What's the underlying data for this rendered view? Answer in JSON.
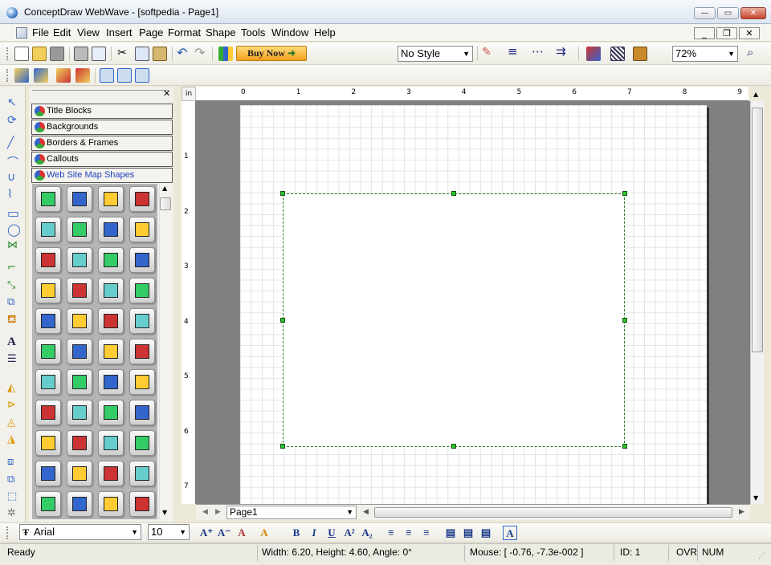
{
  "window": {
    "title": "ConceptDraw WebWave - [softpedia - Page1]",
    "minimize": "—",
    "maximize": "▭",
    "close": "✕"
  },
  "menu": {
    "items": [
      "File",
      "Edit",
      "View",
      "Insert",
      "Page",
      "Format",
      "Shape",
      "Tools",
      "Window",
      "Help"
    ],
    "mdi_min": "_",
    "mdi_restore": "❐",
    "mdi_close": "✕"
  },
  "toolbar": {
    "buy_now": "Buy Now",
    "style_value": "No Style",
    "zoom_value": "72%"
  },
  "library": {
    "tabs": [
      "Title Blocks",
      "Backgrounds",
      "Borders & Frames",
      "Callouts",
      "Web Site Map Shapes"
    ],
    "active_tab_color": "#1f3fbf",
    "icons": [
      [
        "page",
        "home",
        "folder",
        "FTP"
      ],
      [
        "mail",
        "servers",
        "find-doc",
        "find-doc"
      ],
      [
        "P",
        "scroll",
        "JS",
        "shapes"
      ],
      [
        "play",
        "save",
        "?",
        "home-x"
      ],
      [
        "x-doc",
        "ie-doc",
        "mail-doc",
        "dollar-doc"
      ],
      [
        "php-doc",
        "PHP",
        "ASP",
        "ASP.NET"
      ],
      [
        "pen-doc",
        "blank-doc",
        "text-doc",
        "home-doc"
      ],
      [
        "FTP",
        "folder",
        "mail",
        "servers"
      ],
      [
        "find",
        "find",
        "P",
        "scroll"
      ],
      [
        "JS",
        "shapes",
        "play",
        "save"
      ],
      [
        "?",
        "home-x",
        "x",
        "ie"
      ]
    ]
  },
  "ruler": {
    "unit": "in",
    "h_labels": [
      "0",
      "1",
      "2",
      "3",
      "4",
      "5",
      "6",
      "7",
      "8",
      "9"
    ],
    "v_labels": [
      "1",
      "2",
      "3",
      "4",
      "5",
      "6",
      "7"
    ]
  },
  "page_tab": {
    "label": "Page1"
  },
  "format": {
    "font": "Arial",
    "size": "10"
  },
  "status": {
    "ready": "Ready",
    "dims": "Width: 6.20,  Height: 4.60,  Angle: 0°",
    "mouse": "Mouse: [ -0.76, -7.3e-002 ]",
    "id": "ID: 1",
    "ovr": "OVR",
    "num": "NUM"
  }
}
